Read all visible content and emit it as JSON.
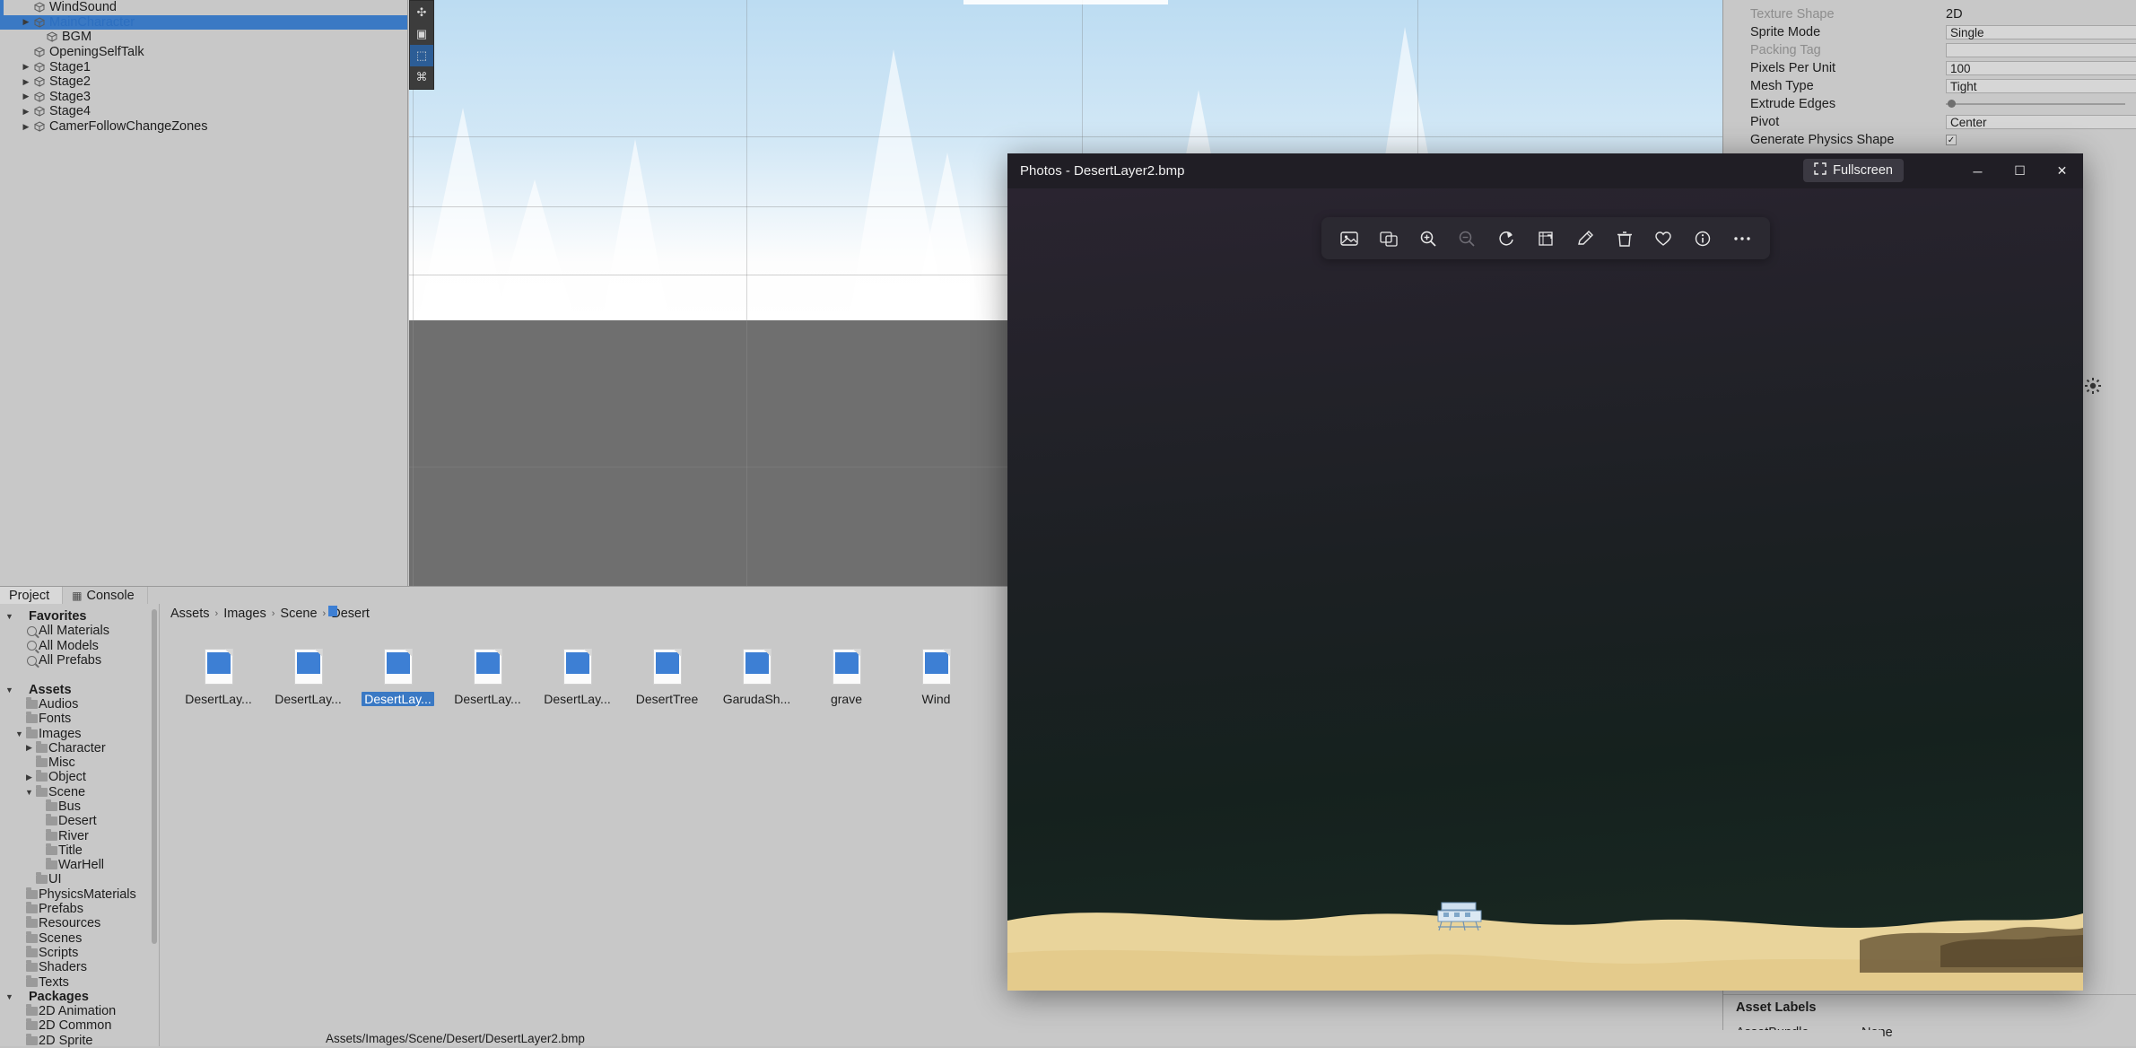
{
  "hierarchy": {
    "items": [
      {
        "label": "WindSound",
        "indent": 1,
        "twisty": "",
        "icon": "cube-icon",
        "selected": false,
        "blue": false
      },
      {
        "label": "MainCharacter",
        "indent": 1,
        "twisty": "▶",
        "icon": "cube-icon",
        "selected": true,
        "blue": true
      },
      {
        "label": "BGM",
        "indent": 2,
        "twisty": "",
        "icon": "cube-icon",
        "selected": false,
        "blue": false
      },
      {
        "label": "OpeningSelfTalk",
        "indent": 1,
        "twisty": "",
        "icon": "cube-icon",
        "selected": false,
        "blue": false
      },
      {
        "label": "Stage1",
        "indent": 1,
        "twisty": "▶",
        "icon": "cube-icon",
        "selected": false,
        "blue": false
      },
      {
        "label": "Stage2",
        "indent": 1,
        "twisty": "▶",
        "icon": "cube-icon",
        "selected": false,
        "blue": false
      },
      {
        "label": "Stage3",
        "indent": 1,
        "twisty": "▶",
        "icon": "cube-icon",
        "selected": false,
        "blue": false
      },
      {
        "label": "Stage4",
        "indent": 1,
        "twisty": "▶",
        "icon": "cube-icon",
        "selected": false,
        "blue": false
      },
      {
        "label": "CamerFollowChangeZones",
        "indent": 1,
        "twisty": "▶",
        "icon": "cube-icon",
        "selected": false,
        "blue": false
      }
    ]
  },
  "scene": {
    "gizmo_buttons": [
      {
        "name": "pan-tool",
        "glyph": "✣",
        "active": false
      },
      {
        "name": "rect-tool",
        "glyph": "▣",
        "active": false
      },
      {
        "name": "rect-transform-tool",
        "glyph": "⬚",
        "active": true
      },
      {
        "name": "custom-tool",
        "glyph": "⌘",
        "active": false
      }
    ]
  },
  "inspector": {
    "rows": [
      {
        "key": "Texture Shape",
        "value": "2D",
        "dim": true,
        "type": "text"
      },
      {
        "key": "Sprite Mode",
        "value": "Single",
        "dim": false,
        "type": "field"
      },
      {
        "key": "Packing Tag",
        "value": "",
        "dim": true,
        "type": "field"
      },
      {
        "key": "Pixels Per Unit",
        "value": "100",
        "dim": false,
        "type": "field"
      },
      {
        "key": "Mesh Type",
        "value": "Tight",
        "dim": false,
        "type": "field"
      },
      {
        "key": "Extrude Edges",
        "value": "",
        "dim": false,
        "type": "slider"
      },
      {
        "key": "Pivot",
        "value": "Center",
        "dim": false,
        "type": "field"
      },
      {
        "key": "Generate Physics Shape",
        "value": "✓",
        "dim": false,
        "type": "check"
      }
    ],
    "asset_labels": {
      "title": "Asset Labels",
      "bundle_key": "AssetBundle",
      "bundle_value": "None"
    }
  },
  "project_panel": {
    "tabs": [
      {
        "label": "Project",
        "icon": "",
        "active": true
      },
      {
        "label": "Console",
        "icon": "console-icon",
        "active": false
      }
    ],
    "breadcrumb": [
      "Assets",
      "Images",
      "Scene",
      "Desert"
    ],
    "tree": [
      {
        "label": "Favorites",
        "bold": true,
        "indent": 0,
        "icon": "none",
        "twisty": "▼"
      },
      {
        "label": "All Materials",
        "bold": false,
        "indent": 1,
        "icon": "search",
        "twisty": ""
      },
      {
        "label": "All Models",
        "bold": false,
        "indent": 1,
        "icon": "search",
        "twisty": ""
      },
      {
        "label": "All Prefabs",
        "bold": false,
        "indent": 1,
        "icon": "search",
        "twisty": ""
      },
      {
        "label": "",
        "bold": false,
        "indent": 0,
        "icon": "none",
        "twisty": ""
      },
      {
        "label": "Assets",
        "bold": true,
        "indent": 0,
        "icon": "none",
        "twisty": "▼"
      },
      {
        "label": "Audios",
        "bold": false,
        "indent": 1,
        "icon": "folder",
        "twisty": ""
      },
      {
        "label": "Fonts",
        "bold": false,
        "indent": 1,
        "icon": "folder",
        "twisty": ""
      },
      {
        "label": "Images",
        "bold": false,
        "indent": 1,
        "icon": "folder",
        "twisty": "▼"
      },
      {
        "label": "Character",
        "bold": false,
        "indent": 2,
        "icon": "folder",
        "twisty": "▶"
      },
      {
        "label": "Misc",
        "bold": false,
        "indent": 2,
        "icon": "folder",
        "twisty": ""
      },
      {
        "label": "Object",
        "bold": false,
        "indent": 2,
        "icon": "folder",
        "twisty": "▶"
      },
      {
        "label": "Scene",
        "bold": false,
        "indent": 2,
        "icon": "folder",
        "twisty": "▼"
      },
      {
        "label": "Bus",
        "bold": false,
        "indent": 3,
        "icon": "folder",
        "twisty": ""
      },
      {
        "label": "Desert",
        "bold": false,
        "indent": 3,
        "icon": "folder",
        "twisty": ""
      },
      {
        "label": "River",
        "bold": false,
        "indent": 3,
        "icon": "folder",
        "twisty": ""
      },
      {
        "label": "Title",
        "bold": false,
        "indent": 3,
        "icon": "folder",
        "twisty": ""
      },
      {
        "label": "WarHell",
        "bold": false,
        "indent": 3,
        "icon": "folder",
        "twisty": ""
      },
      {
        "label": "UI",
        "bold": false,
        "indent": 2,
        "icon": "folder",
        "twisty": ""
      },
      {
        "label": "PhysicsMaterials",
        "bold": false,
        "indent": 1,
        "icon": "folder",
        "twisty": ""
      },
      {
        "label": "Prefabs",
        "bold": false,
        "indent": 1,
        "icon": "folder",
        "twisty": ""
      },
      {
        "label": "Resources",
        "bold": false,
        "indent": 1,
        "icon": "folder",
        "twisty": ""
      },
      {
        "label": "Scenes",
        "bold": false,
        "indent": 1,
        "icon": "folder",
        "twisty": ""
      },
      {
        "label": "Scripts",
        "bold": false,
        "indent": 1,
        "icon": "folder",
        "twisty": ""
      },
      {
        "label": "Shaders",
        "bold": false,
        "indent": 1,
        "icon": "folder",
        "twisty": ""
      },
      {
        "label": "Texts",
        "bold": false,
        "indent": 1,
        "icon": "folder",
        "twisty": ""
      },
      {
        "label": "Packages",
        "bold": true,
        "indent": 0,
        "icon": "none",
        "twisty": "▼"
      },
      {
        "label": "2D Animation",
        "bold": false,
        "indent": 1,
        "icon": "folder",
        "twisty": ""
      },
      {
        "label": "2D Common",
        "bold": false,
        "indent": 1,
        "icon": "folder",
        "twisty": ""
      },
      {
        "label": "2D Sprite",
        "bold": false,
        "indent": 1,
        "icon": "folder",
        "twisty": ""
      }
    ],
    "assets": [
      {
        "label": "DesertLay...",
        "selected": false
      },
      {
        "label": "DesertLay...",
        "selected": false
      },
      {
        "label": "DesertLay...",
        "selected": true
      },
      {
        "label": "DesertLay...",
        "selected": false
      },
      {
        "label": "DesertLay...",
        "selected": false
      },
      {
        "label": "DesertTree",
        "selected": false
      },
      {
        "label": "GarudaSh...",
        "selected": false
      },
      {
        "label": "grave",
        "selected": false
      },
      {
        "label": "Wind",
        "selected": false
      }
    ],
    "status_path": "Assets/Images/Scene/Desert/DesertLayer2.bmp"
  },
  "photos_window": {
    "title": "Photos - DesertLayer2.bmp",
    "fullscreen_label": "Fullscreen",
    "fullscreen_icon": "expand-icon",
    "window_buttons": [
      {
        "name": "minimize-button",
        "glyph": "─"
      },
      {
        "name": "maximize-button",
        "glyph": "☐"
      },
      {
        "name": "close-button",
        "glyph": "✕"
      }
    ],
    "toolbar": [
      {
        "name": "view-actual-size-icon",
        "glyph": "❐",
        "dim": false
      },
      {
        "name": "compare-images-icon",
        "glyph": "⧉",
        "dim": false
      },
      {
        "name": "zoom-in-icon",
        "glyph": "+",
        "dim": false
      },
      {
        "name": "zoom-out-icon",
        "glyph": "−",
        "dim": true
      },
      {
        "name": "rotate-icon",
        "glyph": "↻",
        "dim": false
      },
      {
        "name": "crop-icon",
        "glyph": "⌗",
        "dim": false
      },
      {
        "name": "edit-markup-icon",
        "glyph": "✎",
        "dim": false
      },
      {
        "name": "delete-icon",
        "glyph": "Ὕ1",
        "dim": false
      },
      {
        "name": "favorite-icon",
        "glyph": "♡",
        "dim": false
      },
      {
        "name": "info-icon",
        "glyph": "ⓘ",
        "dim": false
      },
      {
        "name": "more-options-icon",
        "glyph": "⋯",
        "dim": false
      }
    ],
    "image_name": "DesertLayer2.bmp"
  },
  "colors": {
    "accent_blue": "#3a79c4",
    "unity_gray": "#c8c8c8",
    "photos_dark": "#1d1b22",
    "sand": "#e9d49b",
    "sand_dark": "#d9bf7d"
  }
}
